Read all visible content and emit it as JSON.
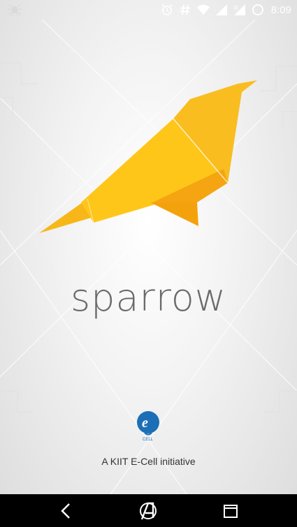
{
  "status_bar": {
    "time": "8:09",
    "left_icon": "spider-icon",
    "icons": [
      "alarm-icon",
      "hashtag-icon",
      "wifi-icon",
      "signal-icon",
      "roaming-signal-icon",
      "battery-icon"
    ],
    "icon_color": "#ffffff"
  },
  "splash": {
    "app_name": "sparrow",
    "tagline": "A KIIT E-Cell initiative",
    "logo": "ecell-bulb-logo",
    "logo_text": "CELL",
    "bird_colors": [
      "#f7b718",
      "#ffc61a",
      "#f5a511",
      "#f9c02a"
    ]
  },
  "nav_bar": {
    "buttons": [
      "back-icon",
      "home-avengers-icon",
      "recents-icon"
    ],
    "background": "#000000"
  }
}
